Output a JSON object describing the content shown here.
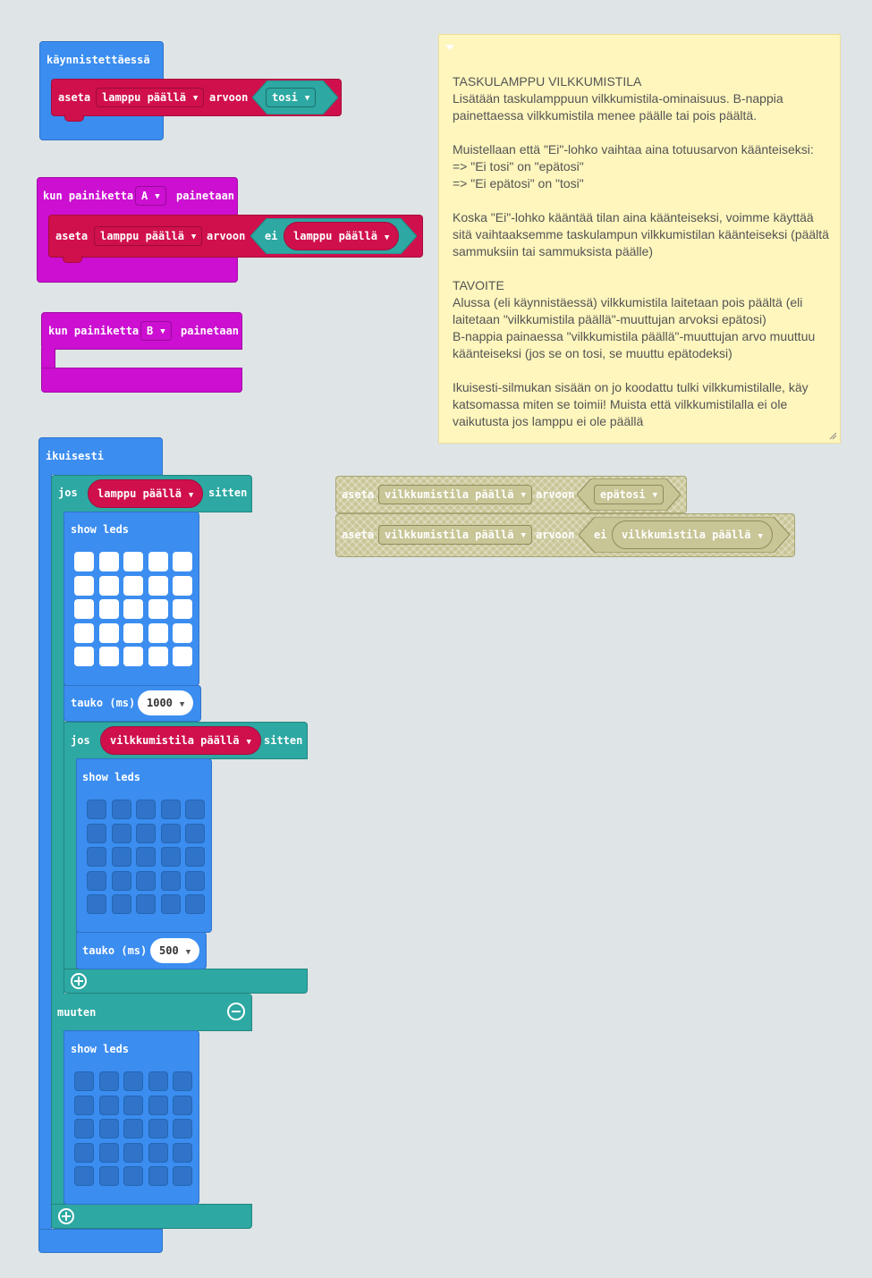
{
  "on_start": {
    "hat_label": "käynnistettäessä",
    "set_label": "aseta",
    "variable": "lamppu päällä",
    "to_label": "arvoon",
    "value": "tosi"
  },
  "button_a": {
    "prefix": "kun painiketta",
    "button": "A",
    "suffix": "painetaan",
    "set_label": "aseta",
    "variable": "lamppu päällä",
    "to_label": "arvoon",
    "not_label": "ei",
    "not_variable": "lamppu päällä"
  },
  "button_b": {
    "prefix": "kun painiketta",
    "button": "B",
    "suffix": "painetaan"
  },
  "forever": {
    "hat_label": "ikuisesti",
    "if_label": "jos",
    "if_condition": "lamppu päällä",
    "then_label": "sitten",
    "show_leds_1": "show leds",
    "pause_label_1": "tauko (ms)",
    "pause_value_1": "1000",
    "inner_if_label": "jos",
    "inner_condition": "vilkkumistila päällä",
    "inner_then_label": "sitten",
    "show_leds_2": "show leds",
    "pause_label_2": "tauko (ms)",
    "pause_value_2": "500",
    "else_label": "muuten",
    "show_leds_3": "show leds",
    "leds_1": [
      [
        1,
        1,
        1,
        1,
        1
      ],
      [
        1,
        1,
        1,
        1,
        1
      ],
      [
        1,
        1,
        1,
        1,
        1
      ],
      [
        1,
        1,
        1,
        1,
        1
      ],
      [
        1,
        1,
        1,
        1,
        1
      ]
    ],
    "leds_2": [
      [
        0,
        0,
        0,
        0,
        0
      ],
      [
        0,
        0,
        0,
        0,
        0
      ],
      [
        0,
        0,
        0,
        0,
        0
      ],
      [
        0,
        0,
        0,
        0,
        0
      ],
      [
        0,
        0,
        0,
        0,
        0
      ]
    ],
    "leds_3": [
      [
        0,
        0,
        0,
        0,
        0
      ],
      [
        0,
        0,
        0,
        0,
        0
      ],
      [
        0,
        0,
        0,
        0,
        0
      ],
      [
        0,
        0,
        0,
        0,
        0
      ],
      [
        0,
        0,
        0,
        0,
        0
      ]
    ]
  },
  "disabled_blocks": {
    "row1": {
      "set_label": "aseta",
      "variable": "vilkkumistila päällä",
      "to_label": "arvoon",
      "value": "epätosi"
    },
    "row2": {
      "set_label": "aseta",
      "variable": "vilkkumistila päällä",
      "to_label": "arvoon",
      "not_label": "ei",
      "not_variable": "vilkkumistila päällä"
    }
  },
  "comment": {
    "text": "TASKULAMPPU VILKKUMISTILA\nLisätään taskulamppuun vilkkumistila-ominaisuus. B-nappia painettaessa vilkkumistila menee päälle tai pois päältä.\n\nMuistellaan että \"Ei\"-lohko vaihtaa aina totuusarvon käänteiseksi:\n=> \"Ei tosi\" on \"epätosi\"\n=> \"Ei epätosi\" on \"tosi\"\n\nKoska \"Ei\"-lohko kääntää tilan aina käänteiseksi, voimme käyttää sitä vaihtaaksemme taskulampun vilkkumistilan käänteiseksi (päältä sammuksiin tai sammuksista päälle)\n\nTAVOITE\nAlussa (eli käynnistäessä) vilkkumistila laitetaan pois päältä (eli laitetaan \"vilkkumistila päällä\"-muuttujan arvoksi epätosi)\nB-nappia painaessa \"vilkkumistila päällä\"-muuttujan arvo muuttuu käänteiseksi (jos se on tosi, se muuttu epätodeksi)\n\nIkuisesti-silmukan sisään on jo koodattu tulki vilkkumistilalle, käy katsomassa miten se toimii! Muista että vilkkumistilalla ei ole vaikutusta jos lamppu ei ole päällä"
  },
  "colors": {
    "workspace": "#ecf0f1",
    "basic": "#3b8df0",
    "input": "#cc0fd1",
    "logic": "#2da8a2",
    "variables": "#d0104c",
    "comment": "#fef6bd"
  }
}
